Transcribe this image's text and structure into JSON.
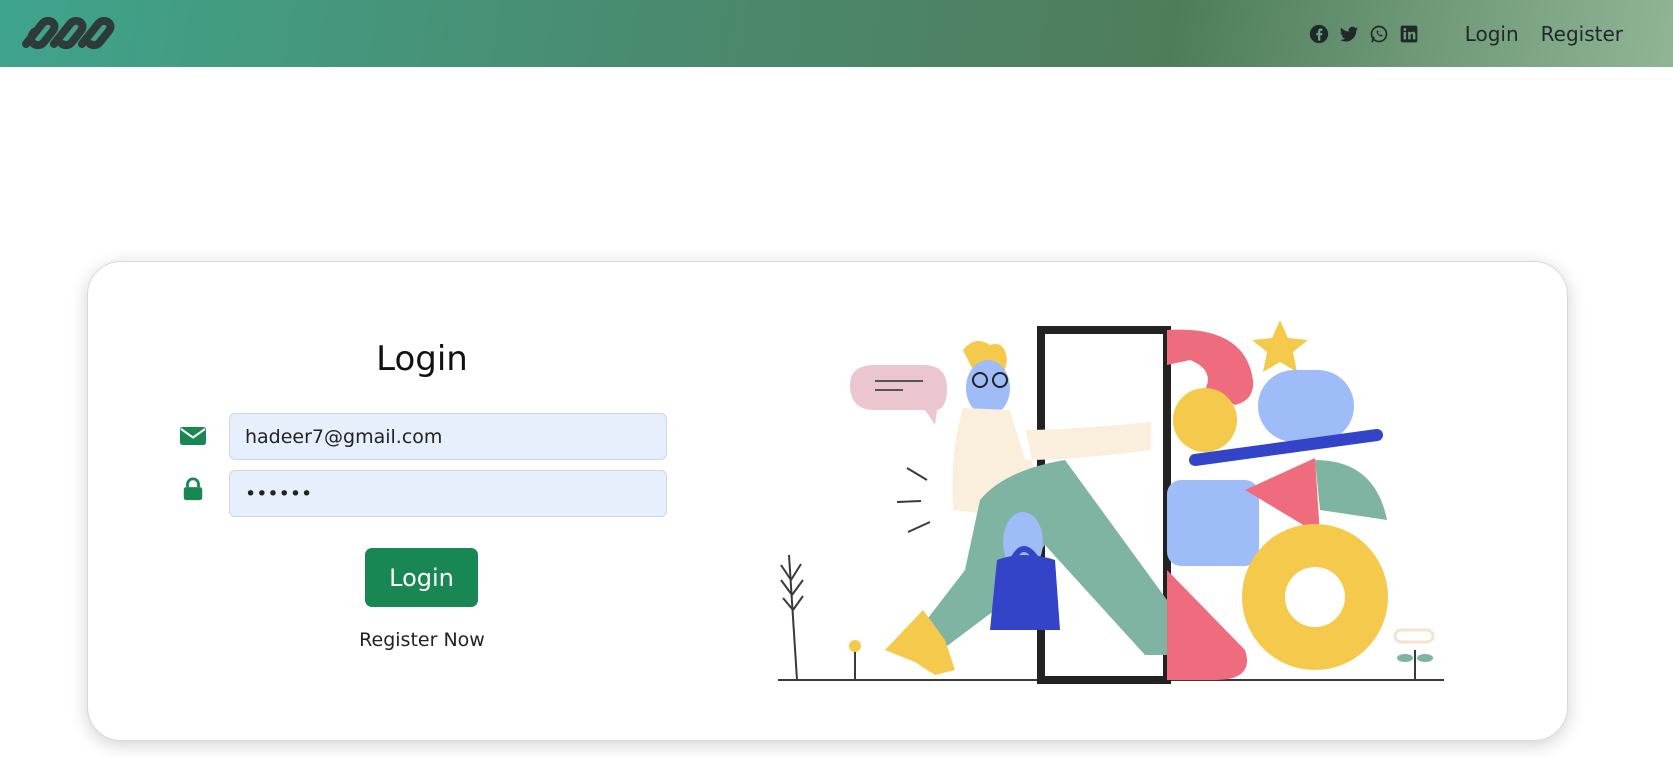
{
  "navbar": {
    "logo_icon": "infinity-chain-logo",
    "social_icons": [
      "facebook-icon",
      "twitter-icon",
      "whatsapp-icon",
      "linkedin-icon"
    ],
    "login_label": "Login",
    "register_label": "Register",
    "colors": {
      "gradient_start": "#3fa48c",
      "gradient_end": "#8fb596"
    }
  },
  "form": {
    "title": "Login",
    "email_value": "hadeer7@gmail.com",
    "password_value": "••••••",
    "email_icon": "envelope-icon",
    "password_icon": "lock-icon",
    "submit_label": "Login",
    "register_link": "Register Now",
    "accent_color": "#198754"
  },
  "illustration": {
    "description_icon": "login-door-illustration"
  }
}
